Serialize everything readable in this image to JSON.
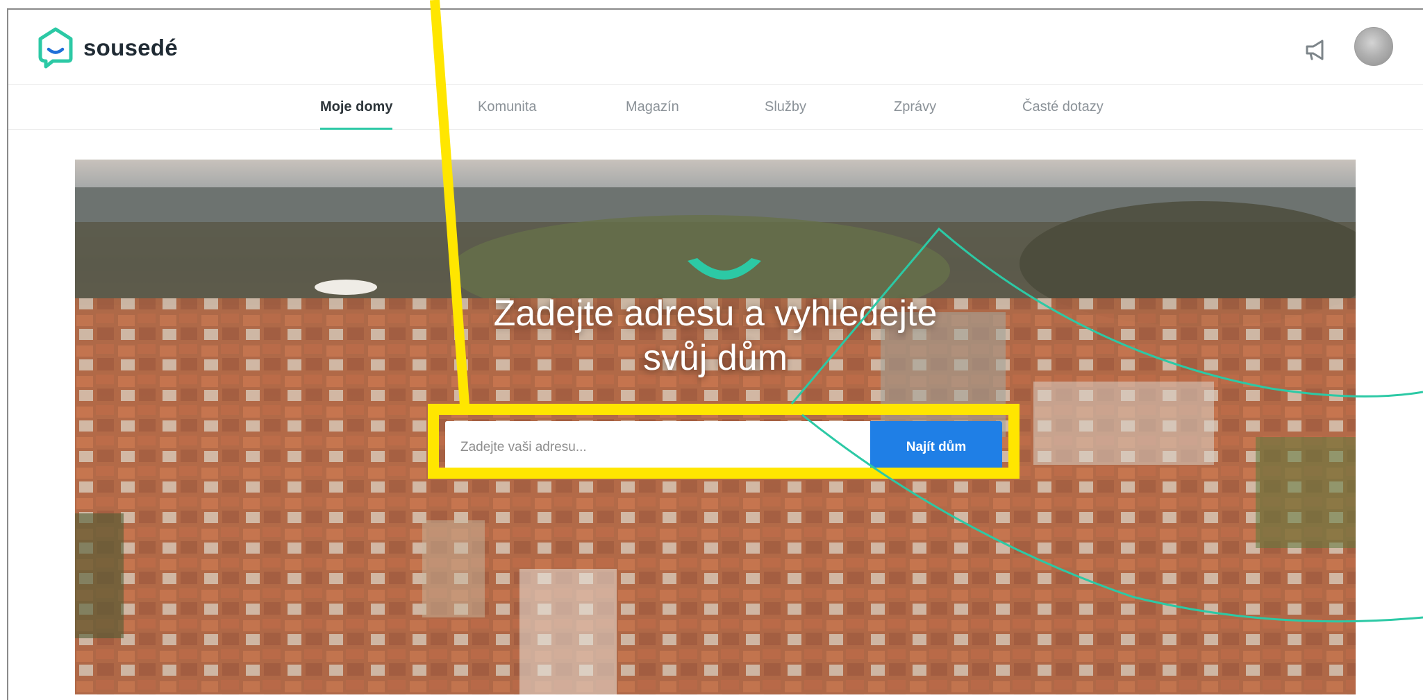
{
  "brand": {
    "name": "sousedé",
    "accent_color": "#2cc9a5",
    "logo_icon": "house-smile-icon"
  },
  "header": {
    "announcements_icon": "megaphone-icon",
    "avatar_icon": "user-avatar"
  },
  "nav": {
    "items": [
      {
        "label": "Moje domy",
        "active": true
      },
      {
        "label": "Komunita",
        "active": false
      },
      {
        "label": "Magazín",
        "active": false
      },
      {
        "label": "Služby",
        "active": false
      },
      {
        "label": "Zprávy",
        "active": false
      },
      {
        "label": "Časté dotazy",
        "active": false
      }
    ]
  },
  "hero": {
    "title_line1": "Zadejte adresu a vyhledejte",
    "title_line2": "svůj dům",
    "search_placeholder": "Zadejte vaši adresu...",
    "search_value": "",
    "button_label": "Najít dům",
    "button_color": "#1f7fe6",
    "highlight_color": "#ffe600"
  }
}
